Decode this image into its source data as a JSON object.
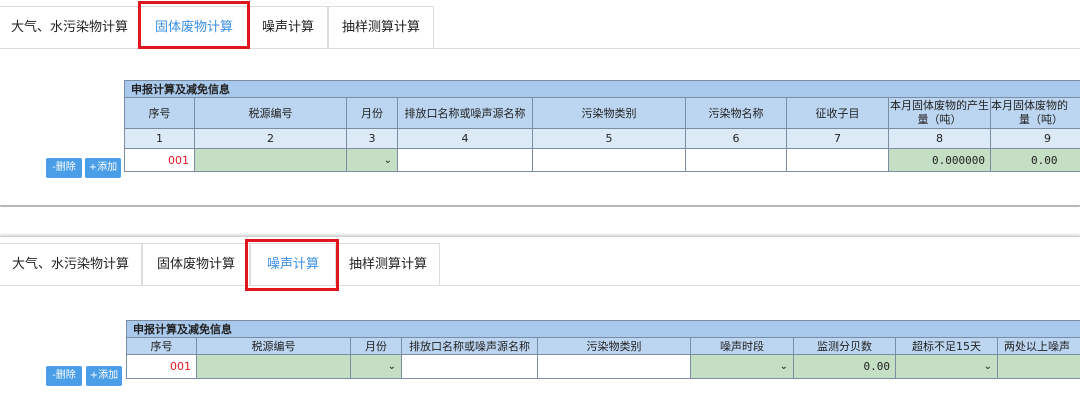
{
  "panel1": {
    "tabs": [
      "大气、水污染物计算",
      "固体废物计算",
      "噪声计算",
      "抽样测算计算"
    ],
    "table_title": "申报计算及减免信息",
    "columns": [
      "序号",
      "税源编号",
      "月份",
      "排放口名称或噪声源名称",
      "污染物类别",
      "污染物名称",
      "征收子目",
      "本月固体废物的产生量（吨）",
      "本月固体废物的"
    ],
    "column_tail": "量（吨）",
    "column_numbers": [
      "1",
      "2",
      "3",
      "4",
      "5",
      "6",
      "7",
      "8",
      "9"
    ],
    "delete_label": "-删除",
    "add_label": "+添加",
    "row": {
      "seq": "001",
      "value8": "0.000000",
      "value9": "0.00"
    }
  },
  "panel2": {
    "tabs": [
      "大气、水污染物计算",
      "固体废物计算",
      "噪声计算",
      "抽样测算计算"
    ],
    "table_title": "申报计算及减免信息",
    "columns": [
      "序号",
      "税源编号",
      "月份",
      "排放口名称或噪声源名称",
      "污染物类别",
      "噪声时段",
      "监测分贝数",
      "超标不足15天",
      "两处以上噪声"
    ],
    "delete_label": "-删除",
    "add_label": "+添加",
    "row": {
      "seq": "001",
      "decibel": "0.00"
    }
  },
  "icons": {
    "dropdown": "chevron-down-icon"
  },
  "colors": {
    "active_tab": "#3a8ee6",
    "highlight": "#e0161f",
    "header": "#bcd5f0",
    "input_green": "#c4dfc4",
    "button": "#4a9ee8"
  }
}
